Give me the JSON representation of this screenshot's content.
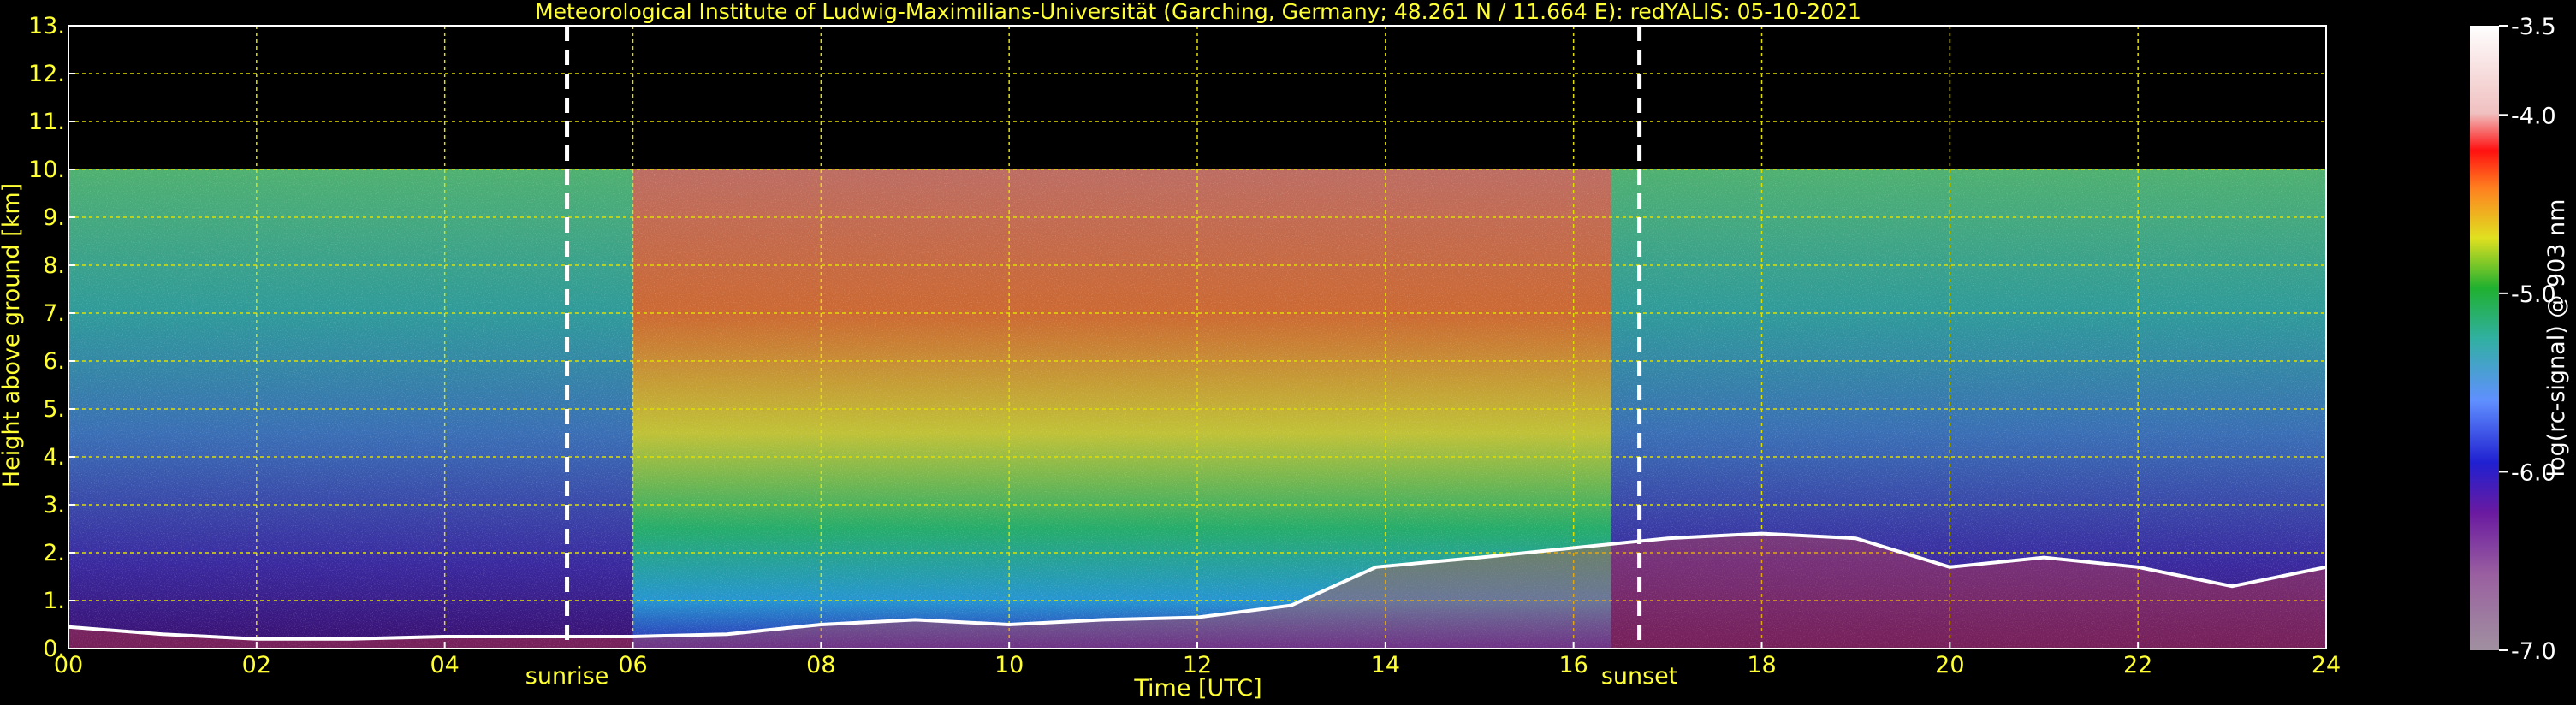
{
  "chart_data": {
    "type": "heatmap",
    "title": "Meteorological Institute of Ludwig-Maximilians-Universität (Garching, Germany; 48.261 N / 11.664 E):     redYALIS: 05-10-2021",
    "xlabel": "Time [UTC]",
    "ylabel": "Height above ground [km]",
    "xlim": [
      0,
      24
    ],
    "ylim": [
      0,
      13
    ],
    "x_ticks": [
      "00",
      "02",
      "04",
      "06",
      "08",
      "10",
      "12",
      "14",
      "16",
      "18",
      "20",
      "22",
      "24"
    ],
    "y_ticks": [
      "0.",
      "1.",
      "2.",
      "3.",
      "4.",
      "5.",
      "6.",
      "7.",
      "8.",
      "9.",
      "10.",
      "11.",
      "12.",
      "13."
    ],
    "grid": true,
    "data_ceiling_km": 10,
    "annotations": [
      {
        "label": "sunrise",
        "x": 5.3
      },
      {
        "label": "sunset",
        "x": 16.7
      }
    ],
    "colorbar": {
      "label": "log(rc-signal) @ 903 nm",
      "range": [
        -7.0,
        -3.5
      ],
      "ticks": [
        "-3.5",
        "-4.0",
        "-5.0",
        "-6.0",
        "-7.0"
      ]
    },
    "cloud_base_km": [
      {
        "t": 0.0,
        "h": 0.45
      },
      {
        "t": 1.0,
        "h": 0.3
      },
      {
        "t": 2.0,
        "h": 0.2
      },
      {
        "t": 3.0,
        "h": 0.2
      },
      {
        "t": 4.0,
        "h": 0.25
      },
      {
        "t": 5.0,
        "h": 0.25
      },
      {
        "t": 6.0,
        "h": 0.25
      },
      {
        "t": 7.0,
        "h": 0.3
      },
      {
        "t": 8.0,
        "h": 0.5
      },
      {
        "t": 9.0,
        "h": 0.6
      },
      {
        "t": 10.0,
        "h": 0.5
      },
      {
        "t": 11.0,
        "h": 0.6
      },
      {
        "t": 12.0,
        "h": 0.65
      },
      {
        "t": 13.0,
        "h": 0.9
      },
      {
        "t": 13.9,
        "h": 1.7
      },
      {
        "t": 15.0,
        "h": 1.9
      },
      {
        "t": 16.0,
        "h": 2.1
      },
      {
        "t": 17.0,
        "h": 2.3
      },
      {
        "t": 18.0,
        "h": 2.4
      },
      {
        "t": 19.0,
        "h": 2.3
      },
      {
        "t": 20.0,
        "h": 1.7
      },
      {
        "t": 21.0,
        "h": 1.9
      },
      {
        "t": 22.0,
        "h": 1.7
      },
      {
        "t": 23.0,
        "h": 1.3
      },
      {
        "t": 24.0,
        "h": 1.7
      }
    ]
  }
}
